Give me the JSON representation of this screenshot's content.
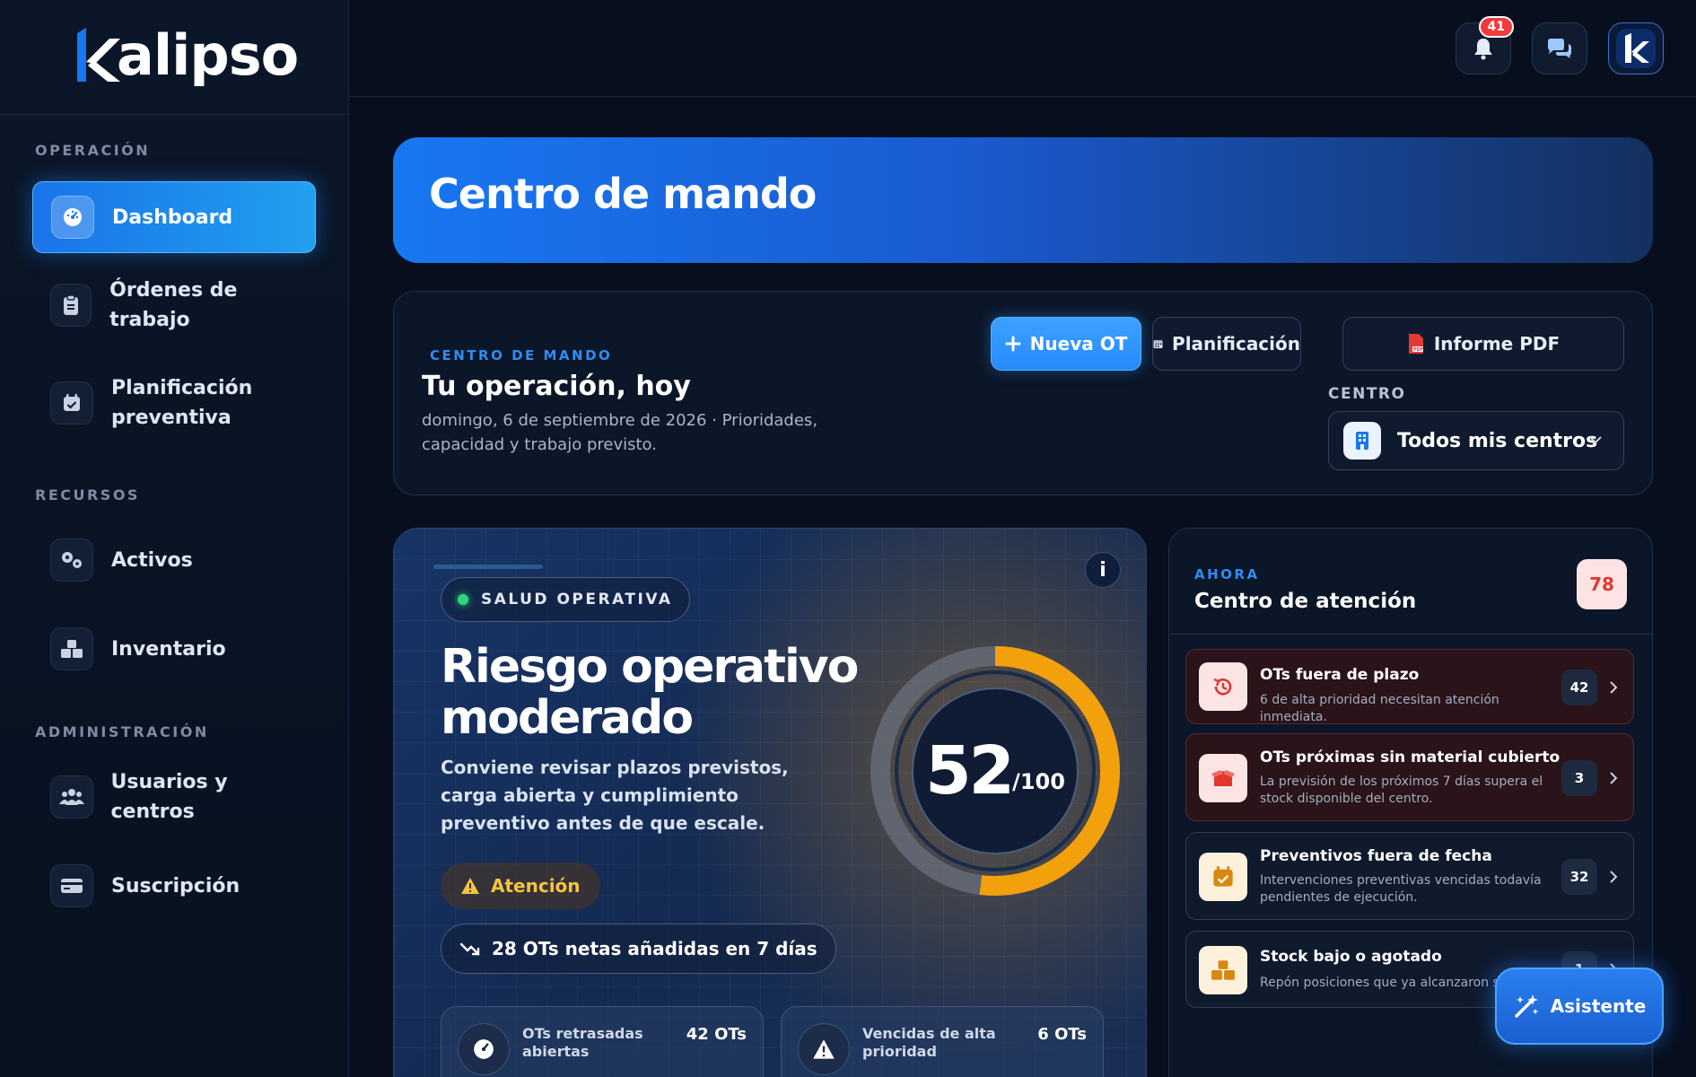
{
  "brand": {
    "name": "kalipso",
    "logo_rest": "alipso",
    "accent": "#1877f2"
  },
  "sidebar": {
    "sections": [
      {
        "label": "OPERACIÓN"
      },
      {
        "label": "RECURSOS"
      },
      {
        "label": "ADMINISTRACIÓN"
      }
    ],
    "items": [
      {
        "label": "Dashboard",
        "icon": "gauge-icon",
        "active": true
      },
      {
        "label": "Órdenes de trabajo",
        "icon": "clipboard-icon"
      },
      {
        "label": "Planificación preventiva",
        "icon": "calendar-check-icon"
      },
      {
        "label": "Activos",
        "icon": "gears-icon"
      },
      {
        "label": "Inventario",
        "icon": "boxes-icon"
      },
      {
        "label": "Usuarios y centros",
        "icon": "users-icon"
      },
      {
        "label": "Suscripción",
        "icon": "credit-card-icon"
      }
    ]
  },
  "topbar": {
    "notifications_count": "41",
    "icons": [
      "bell-icon",
      "chat-icon",
      "avatar"
    ]
  },
  "hero": {
    "title": "Centro de mando"
  },
  "operation": {
    "eyebrow": "CENTRO DE MANDO",
    "title": "Tu operación, hoy",
    "subtitle": "domingo, 6 de septiembre de 2026 · Prioridades, capacidad y trabajo previsto.",
    "buttons": {
      "new_ot": "Nueva OT",
      "planning": "Planificación",
      "pdf": "Informe PDF"
    },
    "centro_label": "CENTRO",
    "centro_value": "Todos mis centros"
  },
  "health": {
    "pill": "SALUD OPERATIVA",
    "info": "i",
    "risk_title": "Riesgo operativo moderado",
    "description": "Conviene revisar plazos previstos, carga abierta y cumplimiento preventivo antes de que escale.",
    "status": "Atención",
    "trend": "28 OTs netas añadidas en 7 días",
    "score": 52,
    "score_max": "/100",
    "score_color": "#f2a00c",
    "kpis": [
      {
        "label": "OTs retrasadas abiertas",
        "value": "42 OTs",
        "icon": "gauge-icon"
      },
      {
        "label": "Vencidas de alta prioridad",
        "value": "6 OTs",
        "icon": "warning-icon"
      }
    ]
  },
  "attention": {
    "eyebrow": "AHORA",
    "title": "Centro de atención",
    "count": "78",
    "items": [
      {
        "title": "OTs fuera de plazo",
        "desc": "6 de alta prioridad necesitan atención inmediata.",
        "count": "42",
        "severity": "red",
        "icon": "history-icon"
      },
      {
        "title": "OTs próximas sin material cubierto",
        "desc": "La previsión de los próximos 7 días supera el stock disponible del centro.",
        "count": "3",
        "severity": "red",
        "icon": "box-open-icon"
      },
      {
        "title": "Preventivos fuera de fecha",
        "desc": "Intervenciones preventivas vencidas todavía pendientes de ejecución.",
        "count": "32",
        "severity": "amber",
        "icon": "calendar-check-icon"
      },
      {
        "title": "Stock bajo o agotado",
        "desc": "Repón posiciones que ya alcanzaron su m",
        "count": "1",
        "severity": "amber",
        "icon": "boxes-icon"
      }
    ]
  },
  "assistant": {
    "label": "Asistente"
  }
}
